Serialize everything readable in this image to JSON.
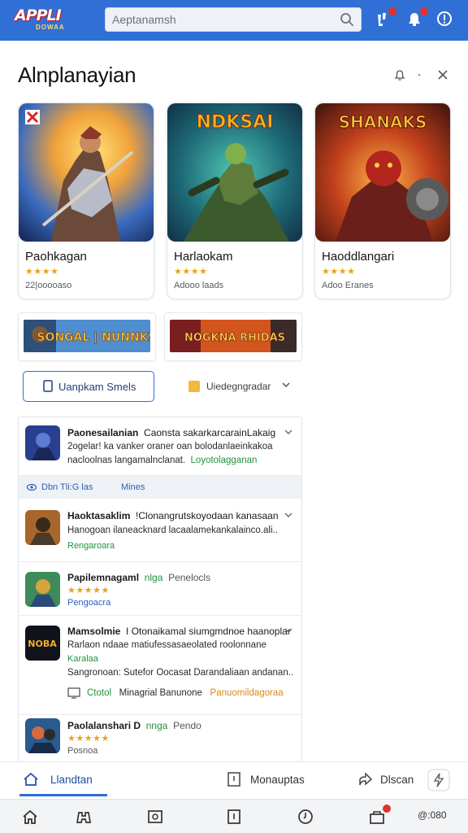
{
  "app": {
    "logo_main": "APPLI",
    "logo_sub": "DOWAA",
    "search_placeholder": "Aeptanamsh"
  },
  "header": {
    "title": "Alnplanayian"
  },
  "featured": [
    {
      "name": "Paohkagan",
      "stars": "★★★★",
      "downloads": "22|ooooaso"
    },
    {
      "name": "Harlaokam",
      "stars": "★★★★",
      "downloads": "Adooo laads"
    },
    {
      "name": "Haoddlangari",
      "stars": "★★★★",
      "downloads": "Adoo Eranes"
    }
  ],
  "banners": [
    {
      "text": "SONGAL | NUNNKS"
    },
    {
      "text": "NOGKNA RHIDAS"
    }
  ],
  "controls": {
    "filter_label": "Uanpkam Smels",
    "sort_label": "Uiedegngradar"
  },
  "list": {
    "section_label": "Dbn Tli:G las",
    "section_link": "Mines",
    "rows": [
      {
        "title": "Paonesailanian",
        "desc": "Caonsta sakarkarcarainLakaig",
        "line2": "2ogelar! ka vanker oraner oan bolodanlaeinkakoa",
        "line3": "nacloolnas langamalnclanat.",
        "link": "Loyotolagganan"
      },
      {
        "title": "Haoktasaklim",
        "desc": "!Clonangrutskoyodaan kanasaan",
        "line2": "Hanogoan ilaneacknard lacaalamekankalainco.ali..",
        "green": "Rengaroara"
      },
      {
        "title": "Papilemnagaml",
        "tag": "nlga",
        "tag2": "Penelocls",
        "stars": "★★★★★",
        "green": "Pengoacra"
      },
      {
        "title": "Mamsolmie",
        "desc": "I Otonaikamal siumgmdnoe haanoplar",
        "line2": "Rarlaon ndaae matiufessasaeolated roolonnane",
        "green": "Karalaa",
        "line3": "Sangronoan: Sutefor Oocasat Darandaliaan andanan..",
        "foot_icon_label": "Ctotol",
        "foot_text": "Minagrial Banunone",
        "foot_green": "Panuomildagoraa"
      },
      {
        "title": "Paolalanshari D",
        "tag": "nnga",
        "tag2": "Pendo",
        "stars": "★★★★★",
        "green": "Posnoa"
      }
    ]
  },
  "tabs": [
    {
      "label": "Llandtan",
      "icon": "home-icon"
    },
    {
      "label": "Monauptas",
      "icon": "book-icon"
    },
    {
      "label": "Dlscan",
      "icon": "share-icon"
    }
  ],
  "sysnav": {
    "counter": "@:080"
  },
  "colors": {
    "brand_blue": "#2f6fd6",
    "star_gold": "#e8a317",
    "link_green": "#22923e",
    "badge_red": "#e0322b"
  }
}
